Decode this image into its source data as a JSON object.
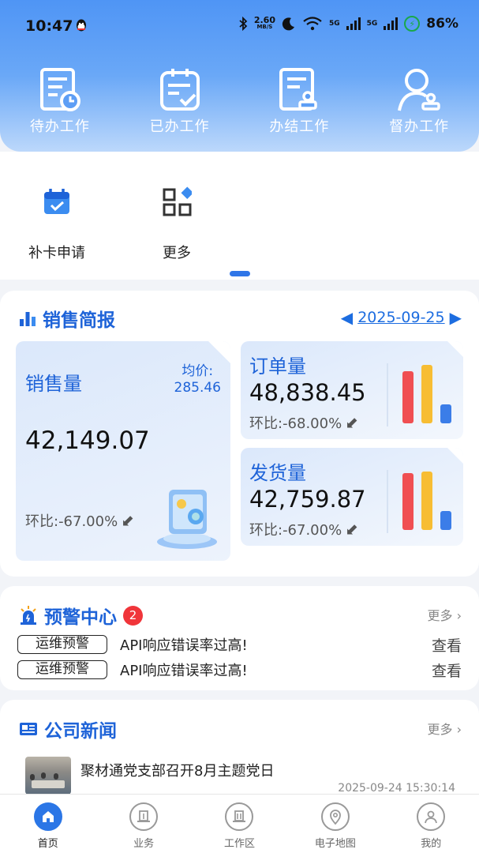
{
  "status": {
    "time": "10:47",
    "net_speed": "2.60",
    "net_unit": "MB/S",
    "sig1": "5G",
    "sig2": "5G",
    "battery": "86%"
  },
  "quick_actions": [
    {
      "label": "待办工作",
      "icon": "todo-doc-icon"
    },
    {
      "label": "已办工作",
      "icon": "done-clipboard-icon"
    },
    {
      "label": "办结工作",
      "icon": "concluded-stamp-icon"
    },
    {
      "label": "督办工作",
      "icon": "supervise-user-icon"
    }
  ],
  "shortcuts": [
    {
      "label": "补卡申请",
      "icon": "calendar-check-icon"
    },
    {
      "label": "更多",
      "icon": "grid-more-icon"
    }
  ],
  "sales_brief": {
    "title": "销售简报",
    "date": "2025-09-25",
    "sales": {
      "label": "销售量",
      "avg_label": "均价:",
      "avg_value": "285.46",
      "value": "42,149.07",
      "ratio": "环比:-67.00%"
    },
    "orders": {
      "label": "订单量",
      "value": "48,838.45",
      "ratio": "环比:-68.00%"
    },
    "shipments": {
      "label": "发货量",
      "value": "42,759.87",
      "ratio": "环比:-67.00%"
    },
    "bar_colors": [
      "#f04f52",
      "#f7bd33",
      "#3b7de8"
    ]
  },
  "alert_center": {
    "title": "预警中心",
    "badge": "2",
    "more": "更多",
    "items": [
      {
        "tag": "运维预警",
        "message": "API响应错误率过高!",
        "action": "查看"
      },
      {
        "tag": "运维预警",
        "message": "API响应错误率过高!",
        "action": "查看"
      }
    ]
  },
  "news": {
    "title": "公司新闻",
    "more": "更多",
    "items": [
      {
        "title": "聚材通党支部召开8月主题党日",
        "time": "2025-09-24 15:30:14"
      }
    ]
  },
  "tabbar": [
    {
      "label": "首页",
      "icon": "home-icon",
      "active": true
    },
    {
      "label": "业务",
      "icon": "business-icon",
      "active": false
    },
    {
      "label": "工作区",
      "icon": "workspace-icon",
      "active": false
    },
    {
      "label": "电子地图",
      "icon": "map-pin-icon",
      "active": false
    },
    {
      "label": "我的",
      "icon": "profile-icon",
      "active": false
    }
  ],
  "colors": {
    "brand": "#1e63d8",
    "badge": "#f0353a",
    "header_top": "#4f95f5"
  }
}
